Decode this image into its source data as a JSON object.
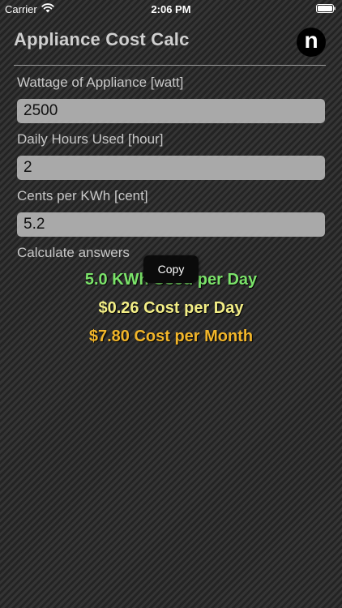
{
  "status_bar": {
    "carrier": "Carrier",
    "time": "2:06 PM",
    "wifi_icon": "wifi-icon",
    "battery_icon": "battery-icon"
  },
  "header": {
    "title": "Appliance Cost Calc",
    "logo_letter": "n"
  },
  "form": {
    "wattage": {
      "label": "Wattage of Appliance [watt]",
      "value": "2500"
    },
    "hours": {
      "label": "Daily Hours Used [hour]",
      "value": "2"
    },
    "cents": {
      "label": "Cents per KWh [cent]",
      "value": "5.2"
    },
    "calculate_label": "Calculate answers"
  },
  "results": {
    "kwh_per_day": "5.0 KWh Used per Day",
    "cost_per_day": "$0.26 Cost per Day",
    "cost_per_month": "$7.80 Cost per Month"
  },
  "popup": {
    "copy_label": "Copy"
  },
  "colors": {
    "kwh": "#7be36a",
    "cost_day": "#f3ee86",
    "cost_month": "#f1b52a"
  }
}
